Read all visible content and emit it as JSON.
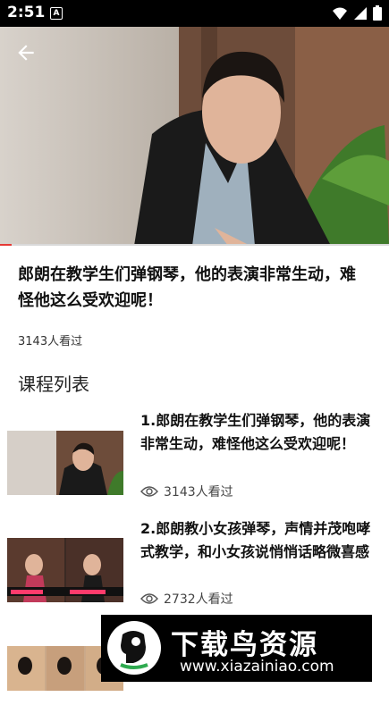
{
  "status_bar": {
    "time": "2:51",
    "notification_badge": "A",
    "icons": [
      "wifi-icon",
      "signal-icon",
      "battery-icon"
    ]
  },
  "video": {
    "progress_fraction": 0.03
  },
  "lesson": {
    "title": "郎朗在教学生们弹钢琴，他的表演非常生动，难怪他这么受欢迎呢！",
    "views": "3143人看过"
  },
  "course_list": {
    "heading": "课程列表",
    "items": [
      {
        "title": "1.郎朗在教学生们弹钢琴，他的表演非常生动，难怪他这么受欢迎呢！",
        "views": "3143人看过"
      },
      {
        "title": "2.郎朗教小女孩弹琴，声情并茂咆哮式教学，和小女孩说悄悄话略微喜感",
        "views": "2732人看过"
      }
    ]
  },
  "watermark": {
    "name": "下载鸟资源",
    "url": "www.xiazainiao.com"
  },
  "colors": {
    "accent_progress": "#e53935",
    "status_bar_bg": "#000000"
  }
}
